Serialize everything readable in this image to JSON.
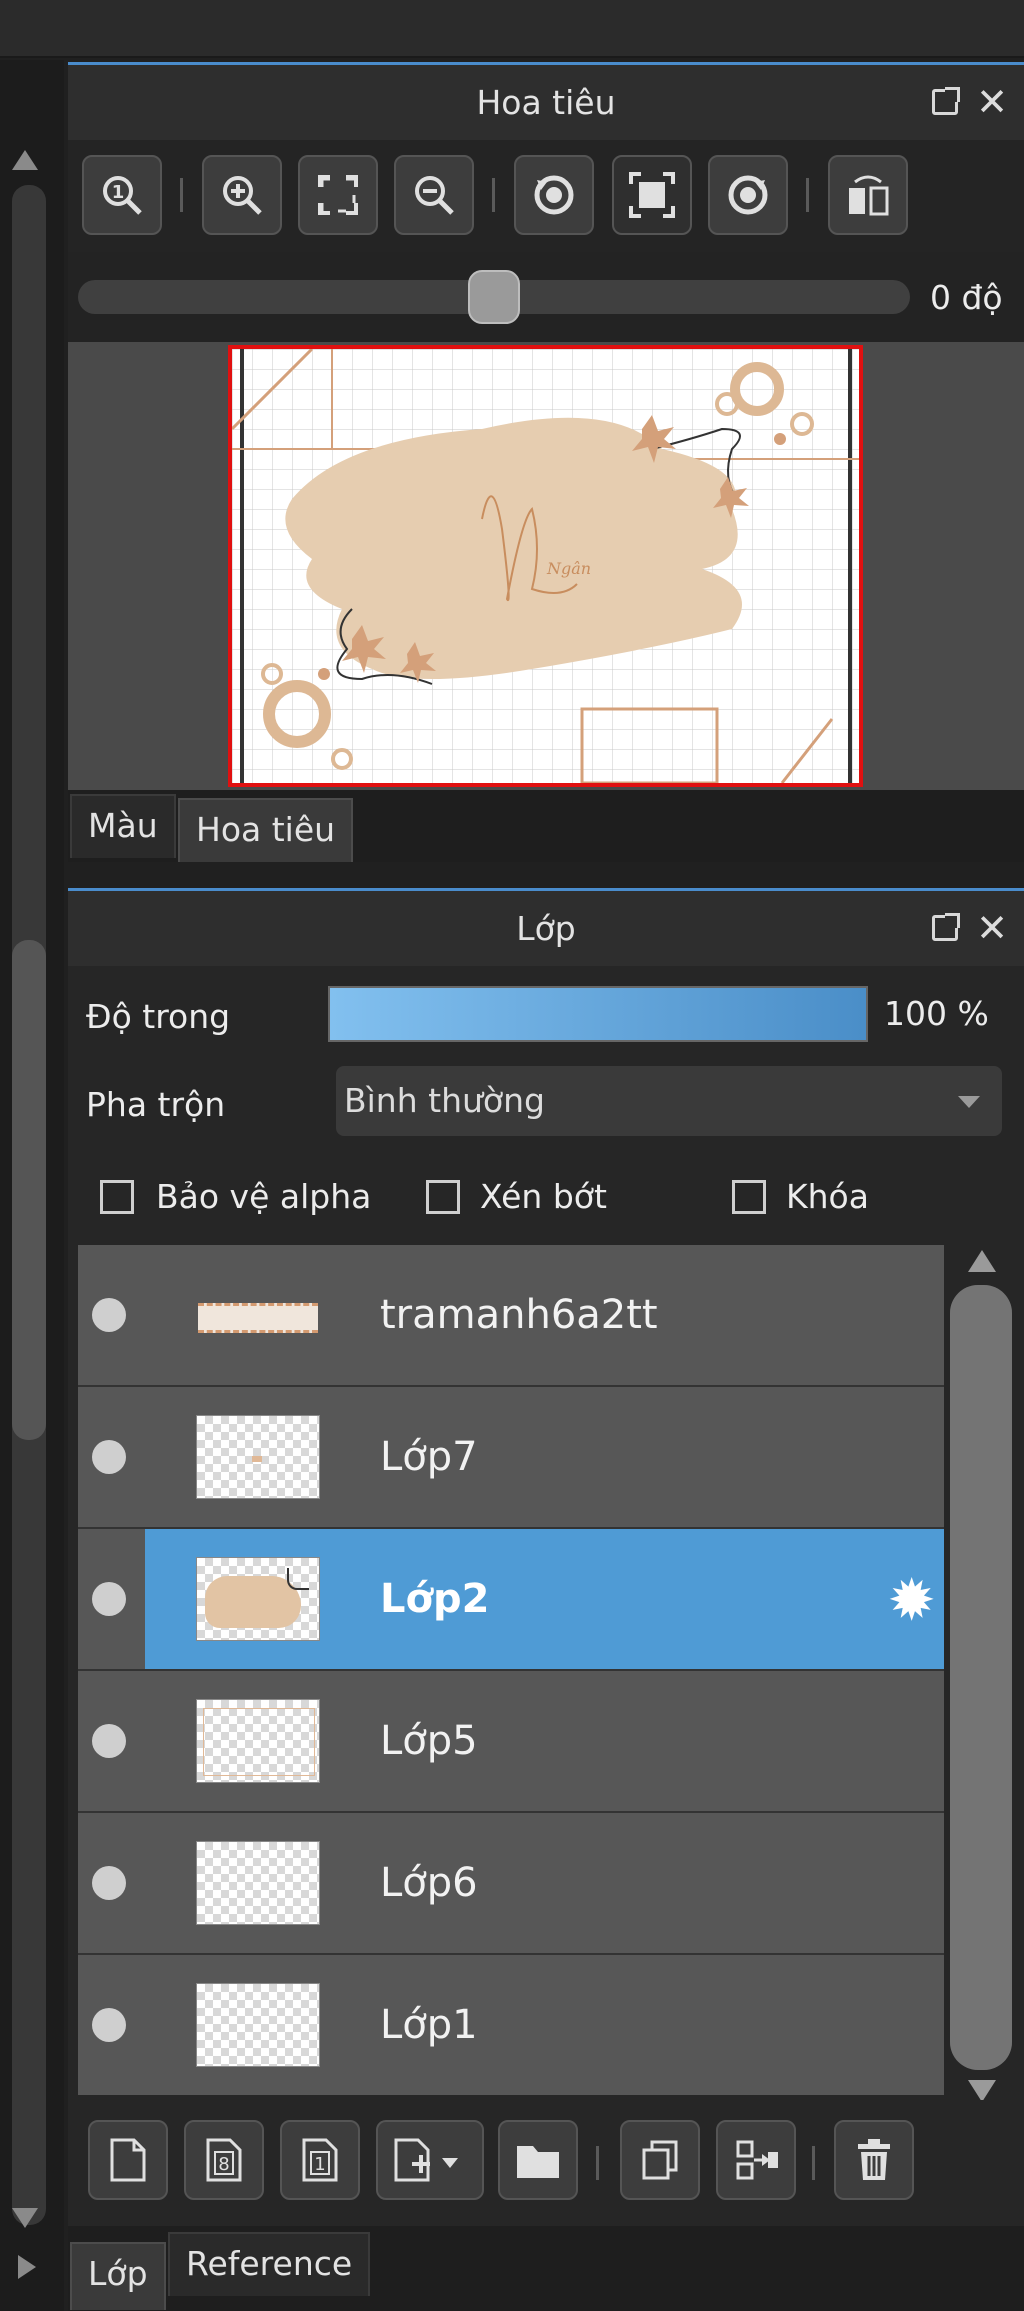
{
  "navigator": {
    "title": "Hoa tiêu",
    "rotation_value": "0 độ",
    "preview_signature": "Ngân",
    "toolbar_icons": [
      "zoom-actual-icon",
      "zoom-in-icon",
      "fit-screen-icon",
      "zoom-out-icon",
      "rotate-left-icon",
      "fit-window-icon",
      "rotate-right-icon",
      "flip-horizontal-icon"
    ],
    "tabs": [
      {
        "label": "Màu",
        "active": false
      },
      {
        "label": "Hoa tiêu",
        "active": true
      }
    ]
  },
  "layers": {
    "title": "Lớp",
    "opacity_label": "Độ trong",
    "opacity_value": "100 %",
    "opacity_fraction": 1.0,
    "blend_label": "Pha trộn",
    "blend_value": "Bình thường",
    "checkboxes": [
      {
        "label": "Bảo vệ alpha",
        "checked": false
      },
      {
        "label": "Xén bớt",
        "checked": false
      },
      {
        "label": "Khóa",
        "checked": false
      }
    ],
    "items": [
      {
        "name": "tramanh6a2tt",
        "selected": false
      },
      {
        "name": "Lớp7",
        "selected": false
      },
      {
        "name": "Lớp2",
        "selected": true
      },
      {
        "name": "Lớp5",
        "selected": false
      },
      {
        "name": "Lớp6",
        "selected": false
      },
      {
        "name": "Lớp1",
        "selected": false
      }
    ],
    "toolbar_icons": [
      "new-layer-icon",
      "new-layer-8bit-icon",
      "new-layer-1bit-icon",
      "add-layer-menu-icon",
      "new-folder-icon",
      "duplicate-layer-icon",
      "merge-down-icon",
      "delete-layer-icon"
    ],
    "tabs": [
      {
        "label": "Lớp",
        "active": true
      },
      {
        "label": "Reference",
        "active": false
      }
    ]
  },
  "colors": {
    "accent": "#4a8ccc",
    "selection": "#4f9bd5",
    "preview_border": "#e01010"
  }
}
